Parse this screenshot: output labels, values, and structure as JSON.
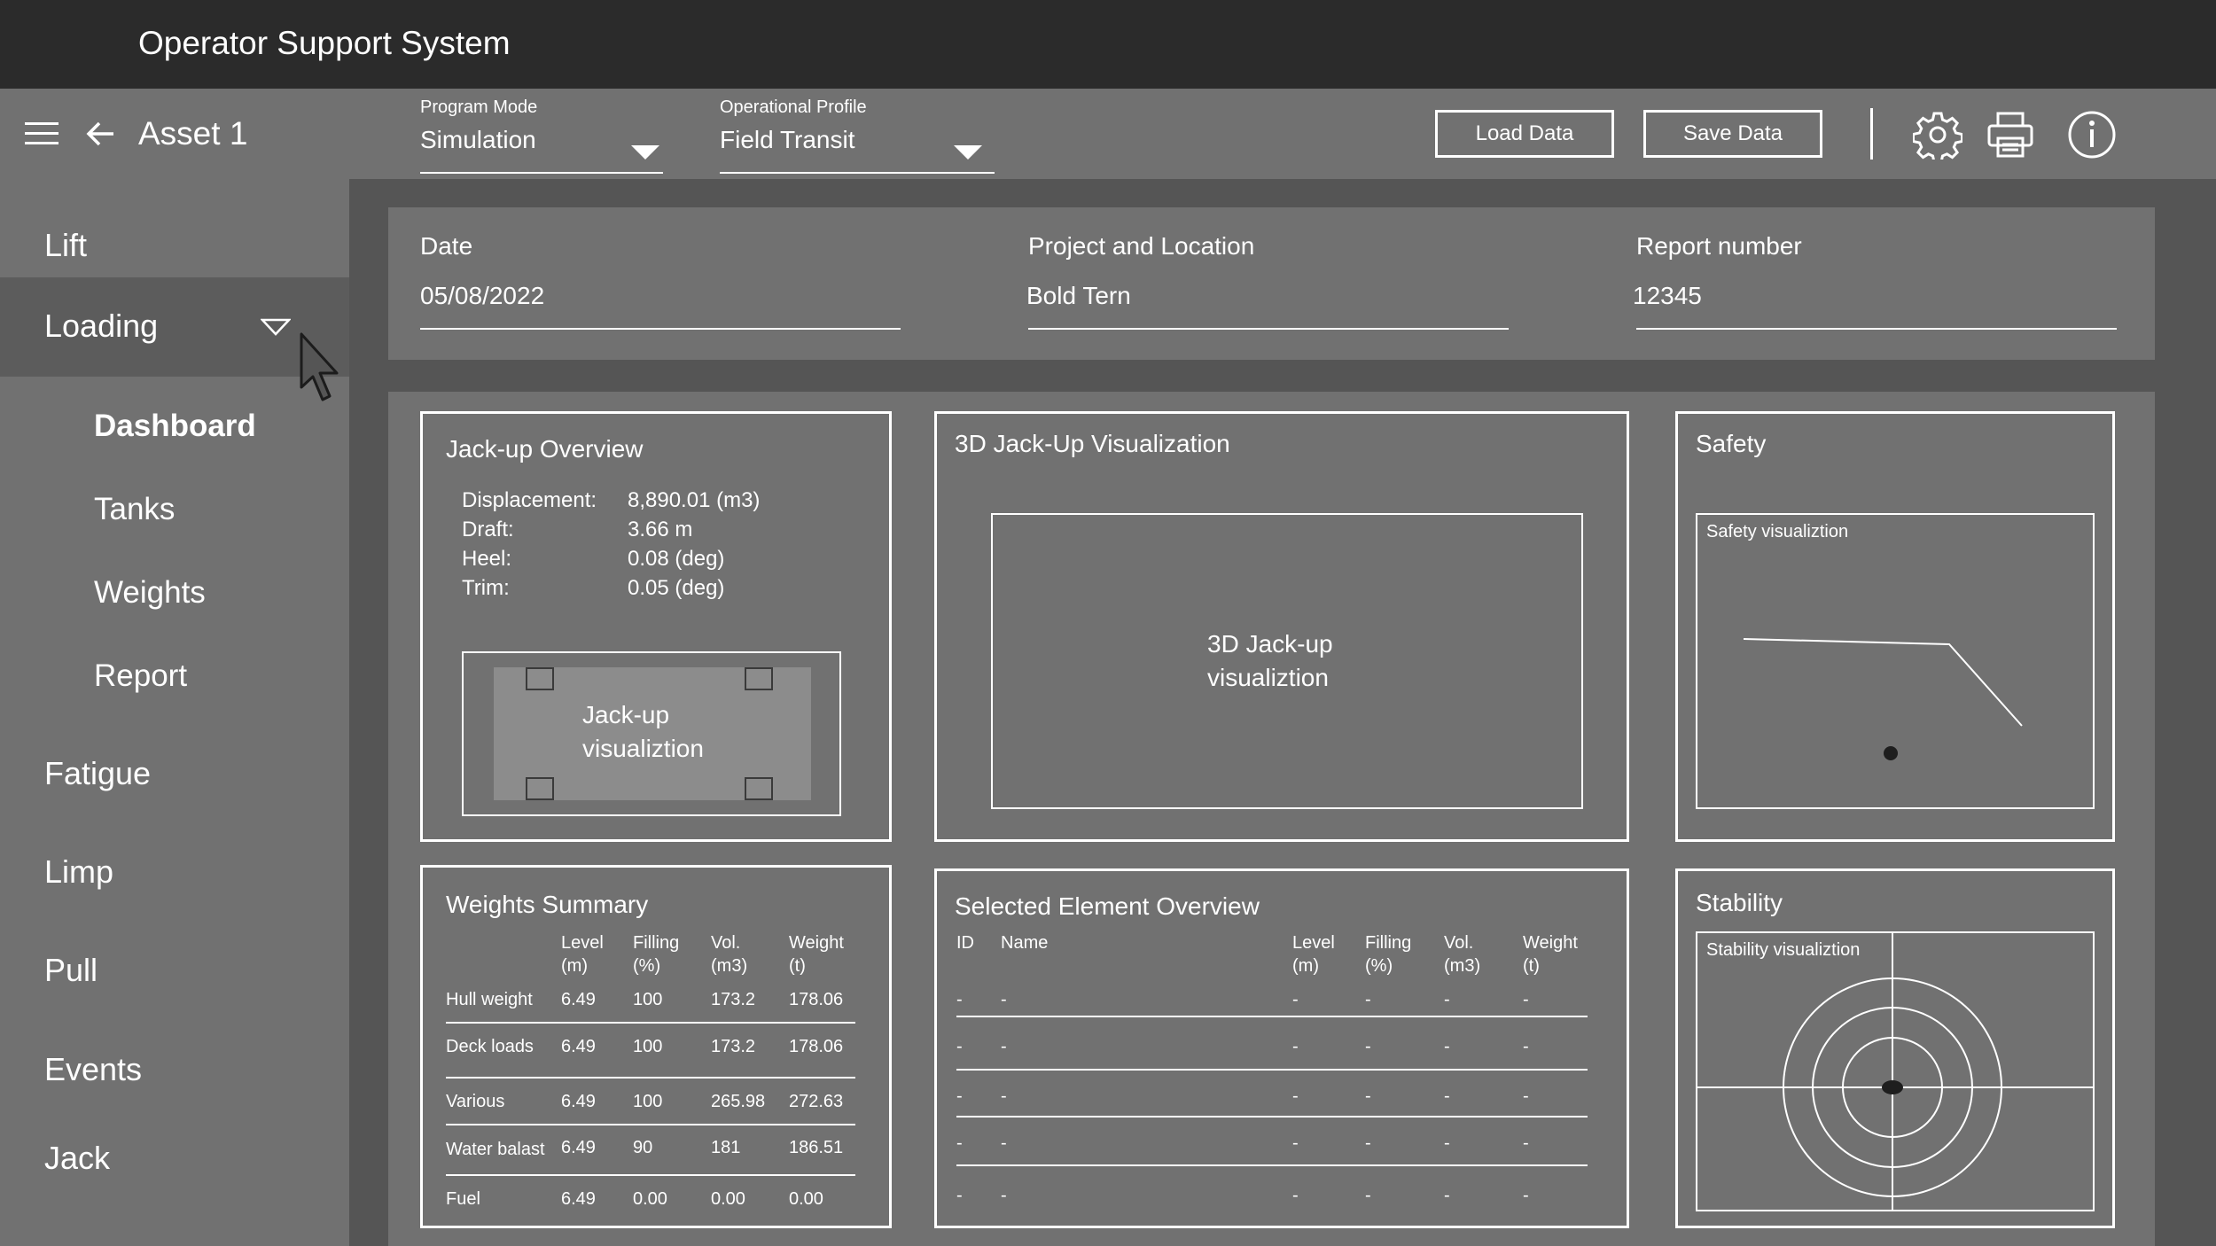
{
  "app": {
    "title": "Operator Support System"
  },
  "toolbar": {
    "asset_title": "Asset 1",
    "program_mode": {
      "label": "Program Mode",
      "value": "Simulation"
    },
    "operational_profile": {
      "label": "Operational Profile",
      "value": "Field Transit"
    },
    "load_label": "Load Data",
    "save_label": "Save Data",
    "icons": [
      "menu-icon",
      "back-arrow-icon",
      "gear-icon",
      "printer-icon",
      "info-icon"
    ]
  },
  "sidebar": {
    "items": [
      {
        "label": "Lift"
      },
      {
        "label": "Loading"
      },
      {
        "label": "Fatigue"
      },
      {
        "label": "Limp"
      },
      {
        "label": "Pull"
      },
      {
        "label": "Events"
      },
      {
        "label": "Jack"
      }
    ],
    "sub_items": [
      {
        "label": "Dashboard"
      },
      {
        "label": "Tanks"
      },
      {
        "label": "Weights"
      },
      {
        "label": "Report"
      }
    ]
  },
  "info": {
    "date": {
      "label": "Date",
      "value": "05/08/2022"
    },
    "project": {
      "label": "Project and Location",
      "value": "Bold Tern"
    },
    "report": {
      "label": "Report number",
      "value": "12345"
    }
  },
  "overview": {
    "title": "Jack-up Overview",
    "rows": [
      {
        "label": "Displacement:",
        "value": "8,890.01 (m3)"
      },
      {
        "label": "Draft:",
        "value": "3.66 m"
      },
      {
        "label": "Heel:",
        "value": "0.08 (deg)"
      },
      {
        "label": "Trim:",
        "value": "0.05 (deg)"
      }
    ],
    "viz_line1": "Jack-up",
    "viz_line2": "visualiztion"
  },
  "viz3d": {
    "title": "3D  Jack-Up Visualization",
    "placeholder_line1": "3D Jack-up",
    "placeholder_line2": "visualiztion"
  },
  "safety": {
    "title": "Safety",
    "viz_label": "Safety visualiztion"
  },
  "weights": {
    "title": "Weights Summary",
    "headers": [
      {
        "l1": "Level",
        "l2": "(m)"
      },
      {
        "l1": "Filling",
        "l2": "(%)"
      },
      {
        "l1": "Vol.",
        "l2": "(m3)"
      },
      {
        "l1": "Weight",
        "l2": "(t)"
      }
    ],
    "rows": [
      {
        "name": "Hull weight",
        "level": "6.49",
        "filling": "100",
        "vol": "173.2",
        "weight": "178.06"
      },
      {
        "name": "Deck loads",
        "level": "6.49",
        "filling": "100",
        "vol": "173.2",
        "weight": "178.06"
      },
      {
        "name": "Various",
        "level": "6.49",
        "filling": "100",
        "vol": "265.98",
        "weight": "272.63"
      },
      {
        "name": "Water balast",
        "level": "6.49",
        "filling": "90",
        "vol": "181",
        "weight": "186.51"
      },
      {
        "name": "Fuel",
        "level": "6.49",
        "filling": "0.00",
        "vol": "0.00",
        "weight": "0.00"
      }
    ]
  },
  "selected": {
    "title": "Selected Element Overview",
    "headers": {
      "id": "ID",
      "name": "Name",
      "level": {
        "l1": "Level",
        "l2": "(m)"
      },
      "filling": {
        "l1": "Filling",
        "l2": "(%)"
      },
      "vol": {
        "l1": "Vol.",
        "l2": "(m3)"
      },
      "weight": {
        "l1": "Weight",
        "l2": "(t)"
      }
    },
    "rows": [
      {
        "id": "-",
        "name": "-",
        "level": "-",
        "filling": "-",
        "vol": "-",
        "weight": "-"
      },
      {
        "id": "-",
        "name": "-",
        "level": "-",
        "filling": "-",
        "vol": "-",
        "weight": "-"
      },
      {
        "id": "-",
        "name": "-",
        "level": "-",
        "filling": "-",
        "vol": "-",
        "weight": "-"
      },
      {
        "id": "-",
        "name": "-",
        "level": "-",
        "filling": "-",
        "vol": "-",
        "weight": "-"
      },
      {
        "id": "-",
        "name": "-",
        "level": "-",
        "filling": "-",
        "vol": "-",
        "weight": "-"
      }
    ]
  },
  "stability": {
    "title": "Stability",
    "viz_label": "Stability visualiztion"
  }
}
